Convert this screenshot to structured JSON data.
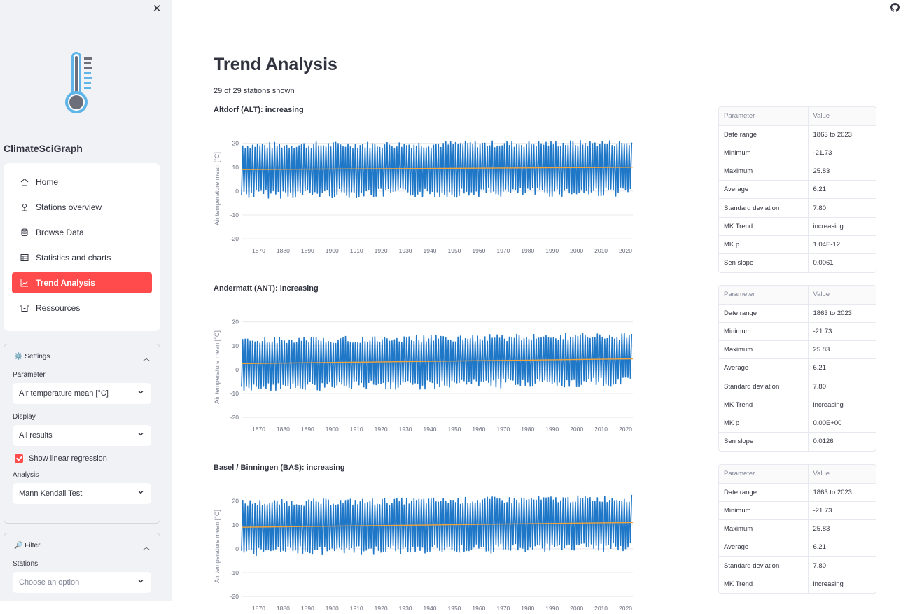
{
  "sidebar": {
    "app_name": "ClimateSciGraph",
    "nav": [
      {
        "label": "Home",
        "icon": "home-icon"
      },
      {
        "label": "Stations overview",
        "icon": "pin-icon"
      },
      {
        "label": "Browse Data",
        "icon": "database-icon"
      },
      {
        "label": "Statistics and charts",
        "icon": "table-icon"
      },
      {
        "label": "Trend Analysis",
        "icon": "trend-icon",
        "active": true
      },
      {
        "label": "Ressources",
        "icon": "archive-icon"
      }
    ],
    "settings": {
      "title": "⚙️ Settings",
      "parameter_label": "Parameter",
      "parameter_value": "Air temperature mean [°C]",
      "display_label": "Display",
      "display_value": "All results",
      "regression_label": "Show linear regression",
      "regression_checked": true,
      "analysis_label": "Analysis",
      "analysis_value": "Mann Kendall Test"
    },
    "filter": {
      "title": "🔎 Filter",
      "stations_label": "Stations",
      "stations_placeholder": "Choose an option"
    }
  },
  "main": {
    "title": "Trend Analysis",
    "subtitle": "29 of 29 stations shown"
  },
  "colors": {
    "accent": "#ff4b4b",
    "series": "#1f77c8",
    "trend": "#f2a33a"
  },
  "stations": [
    {
      "heading": "Altdorf (ALT): increasing",
      "stats_header": [
        "Parameter",
        "Value"
      ],
      "stats": [
        [
          "Date range",
          "1863 to 2023"
        ],
        [
          "Minimum",
          "-21.73"
        ],
        [
          "Maximum",
          "25.83"
        ],
        [
          "Average",
          "6.21"
        ],
        [
          "Standard deviation",
          "7.80"
        ],
        [
          "MK Trend",
          "increasing"
        ],
        [
          "MK p",
          "1.04E-12"
        ],
        [
          "Sen slope",
          "0.0061"
        ]
      ]
    },
    {
      "heading": "Andermatt (ANT): increasing",
      "stats_header": [
        "Parameter",
        "Value"
      ],
      "stats": [
        [
          "Date range",
          "1863 to 2023"
        ],
        [
          "Minimum",
          "-21.73"
        ],
        [
          "Maximum",
          "25.83"
        ],
        [
          "Average",
          "6.21"
        ],
        [
          "Standard deviation",
          "7.80"
        ],
        [
          "MK Trend",
          "increasing"
        ],
        [
          "MK p",
          "0.00E+00"
        ],
        [
          "Sen slope",
          "0.0126"
        ]
      ]
    },
    {
      "heading": "Basel / Binningen (BAS): increasing",
      "stats_header": [
        "Parameter",
        "Value"
      ],
      "stats": [
        [
          "Date range",
          "1863 to 2023"
        ],
        [
          "Minimum",
          "-21.73"
        ],
        [
          "Maximum",
          "25.83"
        ],
        [
          "Average",
          "6.21"
        ],
        [
          "Standard deviation",
          "7.80"
        ],
        [
          "MK Trend",
          "increasing"
        ]
      ]
    }
  ],
  "chart_data": [
    {
      "type": "line",
      "title": "Altdorf (ALT): increasing",
      "ylabel": "Air temperature mean [°C]",
      "xlabel": "",
      "xlim": [
        1863,
        2023
      ],
      "ylim": [
        -22,
        24
      ],
      "yticks": [
        20,
        10,
        0,
        -10,
        -20
      ],
      "xticks": [
        1870,
        1880,
        1890,
        1900,
        1910,
        1920,
        1930,
        1940,
        1950,
        1960,
        1970,
        1980,
        1990,
        2000,
        2010,
        2020
      ],
      "series": [
        {
          "kind": "seasonal-oscillation",
          "mean_start": 9.0,
          "mean_end": 10.0,
          "amplitude": 9.5,
          "noise": 2.0,
          "low_min": -6.5,
          "high_max": 22.5
        },
        {
          "kind": "linear-regression",
          "x": [
            1863,
            2023
          ],
          "y": [
            9.0,
            10.0
          ]
        }
      ],
      "grid": true
    },
    {
      "type": "line",
      "title": "Andermatt (ANT): increasing",
      "ylabel": "Air temperature mean [°C]",
      "xlabel": "",
      "xlim": [
        1863,
        2023
      ],
      "ylim": [
        -22,
        24
      ],
      "yticks": [
        20,
        10,
        0,
        -10,
        -20
      ],
      "xticks": [
        1870,
        1880,
        1890,
        1900,
        1910,
        1920,
        1930,
        1940,
        1950,
        1960,
        1970,
        1980,
        1990,
        2000,
        2010,
        2020
      ],
      "series": [
        {
          "kind": "seasonal-oscillation",
          "mean_start": 2.5,
          "mean_end": 4.5,
          "amplitude": 9.0,
          "noise": 2.0,
          "low_min": -14.0,
          "high_max": 15.5
        },
        {
          "kind": "linear-regression",
          "x": [
            1863,
            2023
          ],
          "y": [
            2.5,
            4.5
          ]
        }
      ],
      "grid": true
    },
    {
      "type": "line",
      "title": "Basel / Binningen (BAS): increasing",
      "ylabel": "Air temperature mean [°C]",
      "xlabel": "",
      "xlim": [
        1863,
        2023
      ],
      "ylim": [
        -22,
        24
      ],
      "yticks": [
        20,
        10,
        0,
        -10,
        -20
      ],
      "xticks": [
        1870,
        1880,
        1890,
        1900,
        1910,
        1920,
        1930,
        1940,
        1950,
        1960,
        1970,
        1980,
        1990,
        2000,
        2010,
        2020
      ],
      "series": [
        {
          "kind": "seasonal-oscillation",
          "mean_start": 9.0,
          "mean_end": 11.0,
          "amplitude": 9.5,
          "noise": 2.0,
          "low_min": -9.0,
          "high_max": 23.5
        },
        {
          "kind": "linear-regression",
          "x": [
            1863,
            2023
          ],
          "y": [
            9.0,
            11.0
          ]
        }
      ],
      "grid": true
    }
  ]
}
